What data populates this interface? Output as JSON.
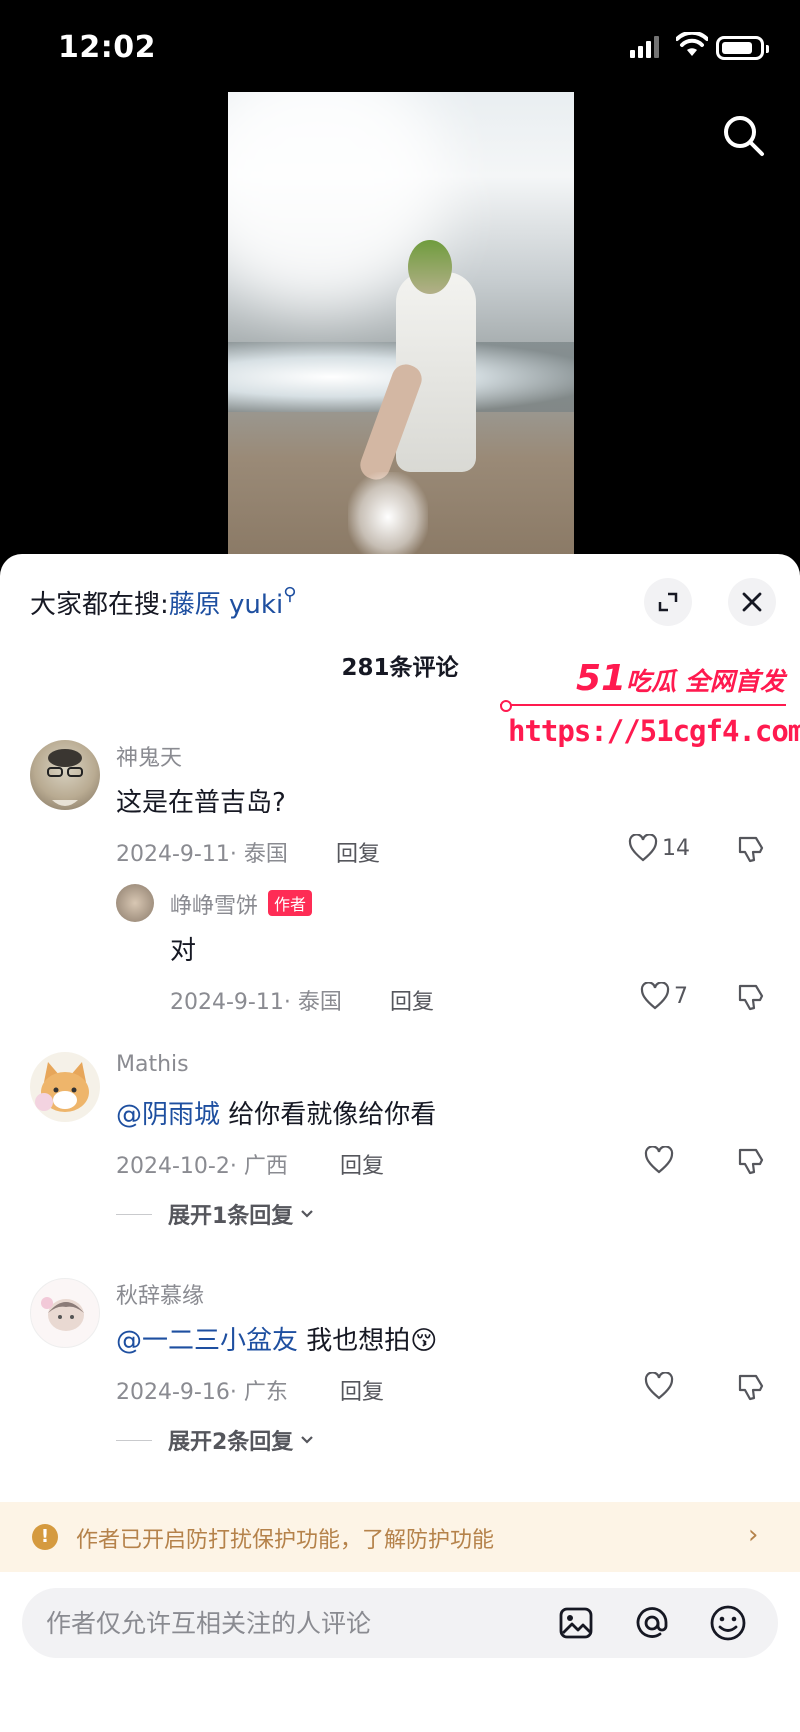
{
  "status_bar": {
    "time": "12:02"
  },
  "header": {
    "search_icon": "search-icon"
  },
  "sheet": {
    "hot_search_prefix": "大家都在搜:",
    "hot_search_keyword": "藤原 yuki",
    "comment_count": "281条评论"
  },
  "watermark": {
    "brand_num": "51",
    "brand_text": "吃瓜 全网首发",
    "url": "https://51cgf4.com"
  },
  "comments": [
    {
      "user": "神鬼天",
      "text": "这是在普吉岛?",
      "date_loc": "2024-9-11· 泰国",
      "reply_label": "回复",
      "likes": "14",
      "replies": [
        {
          "user": "峥峥雪饼",
          "tag": "作者",
          "text": "对",
          "date_loc": "2024-9-11· 泰国",
          "reply_label": "回复",
          "likes": "7"
        }
      ]
    },
    {
      "user": "Mathis",
      "mention": "@阴雨城",
      "text": " 给你看就像给你看",
      "date_loc": "2024-10-2· 广西",
      "reply_label": "回复",
      "likes": "",
      "expand_label": "展开1条回复"
    },
    {
      "user": "秋辞慕缘",
      "mention": "@一二三小盆友",
      "text": " 我也想拍",
      "emoji": "😚",
      "date_loc": "2024-9-16· 广东",
      "reply_label": "回复",
      "likes": "",
      "expand_label": "展开2条回复"
    }
  ],
  "notice": {
    "text": "作者已开启防打扰保护功能，了解防护功能"
  },
  "input": {
    "placeholder": "作者仅允许互相关注的人评论"
  },
  "colors": {
    "accent_red": "#fe2c55",
    "mention_blue": "#1e4fa0",
    "notice_bg": "#fdf4e6"
  }
}
